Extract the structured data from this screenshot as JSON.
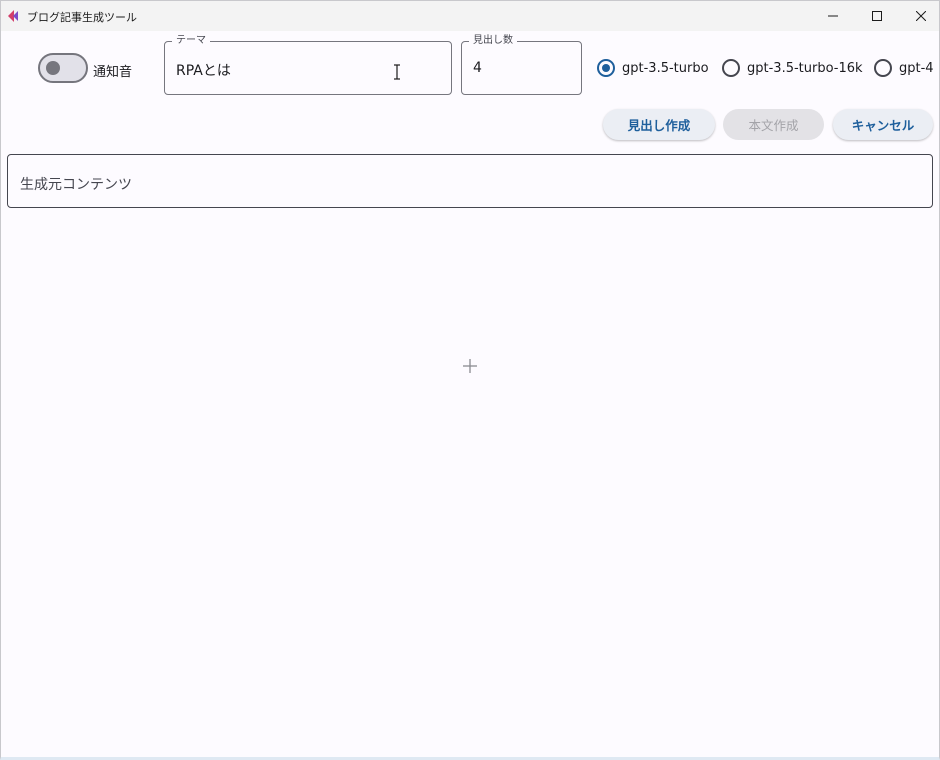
{
  "window": {
    "title": "ブログ記事生成ツール",
    "icon": "app-logo-icon",
    "controls": [
      "minimize-icon",
      "maximize-icon",
      "close-icon"
    ]
  },
  "toolbar": {
    "notification_toggle": {
      "label": "通知音",
      "on": false
    },
    "theme_field": {
      "label": "テーマ",
      "value": "RPAとは"
    },
    "heading_count_field": {
      "label": "見出し数",
      "value": "4"
    },
    "models": [
      {
        "label": "gpt-3.5-turbo",
        "selected": true
      },
      {
        "label": "gpt-3.5-turbo-16k",
        "selected": false
      },
      {
        "label": "gpt-4",
        "selected": false
      }
    ]
  },
  "actions": {
    "create_headings": "見出し作成",
    "create_body": "本文作成",
    "cancel": "キャンセル"
  },
  "source": {
    "placeholder": "生成元コンテンツ"
  },
  "colors": {
    "accent": "#1e5f9c",
    "background": "#fdfbff",
    "outline": "#76767e"
  }
}
